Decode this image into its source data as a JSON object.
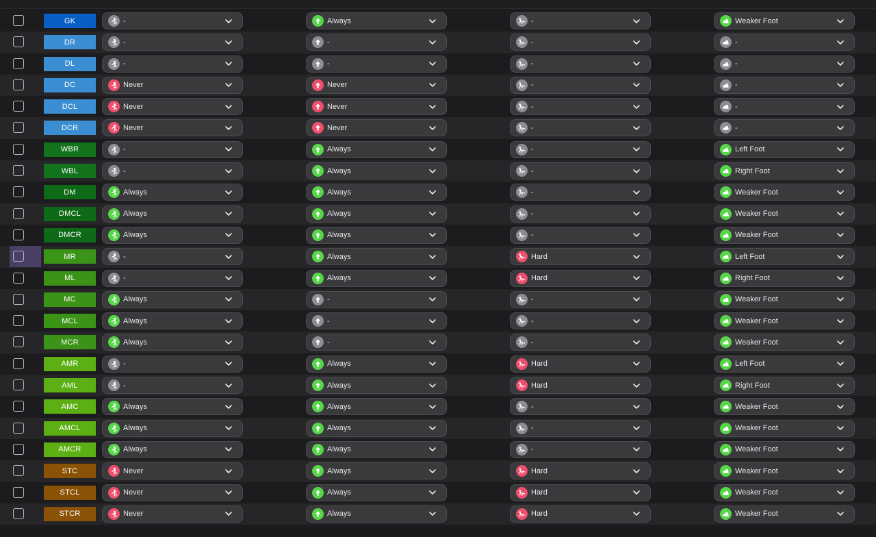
{
  "colors": {
    "grey_status": "#8d8d92",
    "green_status": "#58d64a",
    "red_status": "#ef4f6c",
    "pos_gk": "#0a5fc4",
    "pos_def": "#3b8ed1",
    "pos_wb": "#12731c",
    "pos_dm": "#0e6a17",
    "pos_mid": "#3b9318",
    "pos_am": "#5cb014",
    "pos_st": "#8a5207"
  },
  "icons": {
    "grey_status": "person-icon",
    "green_status": "person-icon",
    "red_status": "person-icon",
    "col1": "run-icon",
    "col2": "arrow-up-icon",
    "col3": "tackle-icon",
    "col4": "foot-icon"
  },
  "rows": [
    {
      "pos": "GK",
      "bg": "#0a5fc4",
      "c1": {
        "label": "-",
        "s": "gray"
      },
      "c2": {
        "label": "Always",
        "s": "green"
      },
      "c3": {
        "label": "-",
        "s": "gray"
      },
      "c4": {
        "label": "Weaker Foot",
        "s": "green"
      }
    },
    {
      "pos": "DR",
      "bg": "#3b8ed1",
      "c1": {
        "label": "-",
        "s": "gray"
      },
      "c2": {
        "label": "-",
        "s": "gray"
      },
      "c3": {
        "label": "-",
        "s": "gray"
      },
      "c4": {
        "label": "-",
        "s": "gray"
      }
    },
    {
      "pos": "DL",
      "bg": "#3b8ed1",
      "c1": {
        "label": "-",
        "s": "gray"
      },
      "c2": {
        "label": "-",
        "s": "gray"
      },
      "c3": {
        "label": "-",
        "s": "gray"
      },
      "c4": {
        "label": "-",
        "s": "gray"
      }
    },
    {
      "pos": "DC",
      "bg": "#3b8ed1",
      "c1": {
        "label": "Never",
        "s": "red"
      },
      "c2": {
        "label": "Never",
        "s": "red"
      },
      "c3": {
        "label": "-",
        "s": "gray"
      },
      "c4": {
        "label": "-",
        "s": "gray"
      }
    },
    {
      "pos": "DCL",
      "bg": "#3b8ed1",
      "c1": {
        "label": "Never",
        "s": "red"
      },
      "c2": {
        "label": "Never",
        "s": "red"
      },
      "c3": {
        "label": "-",
        "s": "gray"
      },
      "c4": {
        "label": "-",
        "s": "gray"
      }
    },
    {
      "pos": "DCR",
      "bg": "#3b8ed1",
      "c1": {
        "label": "Never",
        "s": "red"
      },
      "c2": {
        "label": "Never",
        "s": "red"
      },
      "c3": {
        "label": "-",
        "s": "gray"
      },
      "c4": {
        "label": "-",
        "s": "gray"
      }
    },
    {
      "pos": "WBR",
      "bg": "#12731c",
      "c1": {
        "label": "-",
        "s": "gray"
      },
      "c2": {
        "label": "Always",
        "s": "green"
      },
      "c3": {
        "label": "-",
        "s": "gray"
      },
      "c4": {
        "label": "Left Foot",
        "s": "green"
      }
    },
    {
      "pos": "WBL",
      "bg": "#12731c",
      "c1": {
        "label": "-",
        "s": "gray"
      },
      "c2": {
        "label": "Always",
        "s": "green"
      },
      "c3": {
        "label": "-",
        "s": "gray"
      },
      "c4": {
        "label": "Right Foot",
        "s": "green"
      }
    },
    {
      "pos": "DM",
      "bg": "#0e6a17",
      "c1": {
        "label": "Always",
        "s": "green"
      },
      "c2": {
        "label": "Always",
        "s": "green"
      },
      "c3": {
        "label": "-",
        "s": "gray"
      },
      "c4": {
        "label": "Weaker Foot",
        "s": "green"
      }
    },
    {
      "pos": "DMCL",
      "bg": "#0e6a17",
      "c1": {
        "label": "Always",
        "s": "green"
      },
      "c2": {
        "label": "Always",
        "s": "green"
      },
      "c3": {
        "label": "-",
        "s": "gray"
      },
      "c4": {
        "label": "Weaker Foot",
        "s": "green"
      }
    },
    {
      "pos": "DMCR",
      "bg": "#0e6a17",
      "c1": {
        "label": "Always",
        "s": "green"
      },
      "c2": {
        "label": "Always",
        "s": "green"
      },
      "c3": {
        "label": "-",
        "s": "gray"
      },
      "c4": {
        "label": "Weaker Foot",
        "s": "green"
      }
    },
    {
      "pos": "MR",
      "bg": "#3b9318",
      "selected": true,
      "c1": {
        "label": "-",
        "s": "gray"
      },
      "c2": {
        "label": "Always",
        "s": "green"
      },
      "c3": {
        "label": "Hard",
        "s": "red"
      },
      "c4": {
        "label": "Left Foot",
        "s": "green"
      }
    },
    {
      "pos": "ML",
      "bg": "#3b9318",
      "c1": {
        "label": "-",
        "s": "gray"
      },
      "c2": {
        "label": "Always",
        "s": "green"
      },
      "c3": {
        "label": "Hard",
        "s": "red"
      },
      "c4": {
        "label": "Right Foot",
        "s": "green"
      }
    },
    {
      "pos": "MC",
      "bg": "#3b9318",
      "c1": {
        "label": "Always",
        "s": "green"
      },
      "c2": {
        "label": "-",
        "s": "gray"
      },
      "c3": {
        "label": "-",
        "s": "gray"
      },
      "c4": {
        "label": "Weaker Foot",
        "s": "green"
      }
    },
    {
      "pos": "MCL",
      "bg": "#3b9318",
      "c1": {
        "label": "Always",
        "s": "green"
      },
      "c2": {
        "label": "-",
        "s": "gray"
      },
      "c3": {
        "label": "-",
        "s": "gray"
      },
      "c4": {
        "label": "Weaker Foot",
        "s": "green"
      }
    },
    {
      "pos": "MCR",
      "bg": "#3b9318",
      "c1": {
        "label": "Always",
        "s": "green"
      },
      "c2": {
        "label": "-",
        "s": "gray"
      },
      "c3": {
        "label": "-",
        "s": "gray"
      },
      "c4": {
        "label": "Weaker Foot",
        "s": "green"
      }
    },
    {
      "pos": "AMR",
      "bg": "#5cb014",
      "c1": {
        "label": "-",
        "s": "gray"
      },
      "c2": {
        "label": "Always",
        "s": "green"
      },
      "c3": {
        "label": "Hard",
        "s": "red"
      },
      "c4": {
        "label": "Left Foot",
        "s": "green"
      }
    },
    {
      "pos": "AML",
      "bg": "#5cb014",
      "c1": {
        "label": "-",
        "s": "gray"
      },
      "c2": {
        "label": "Always",
        "s": "green"
      },
      "c3": {
        "label": "Hard",
        "s": "red"
      },
      "c4": {
        "label": "Right Foot",
        "s": "green"
      }
    },
    {
      "pos": "AMC",
      "bg": "#5cb014",
      "c1": {
        "label": "Always",
        "s": "green"
      },
      "c2": {
        "label": "Always",
        "s": "green"
      },
      "c3": {
        "label": "-",
        "s": "gray"
      },
      "c4": {
        "label": "Weaker Foot",
        "s": "green"
      }
    },
    {
      "pos": "AMCL",
      "bg": "#5cb014",
      "c1": {
        "label": "Always",
        "s": "green"
      },
      "c2": {
        "label": "Always",
        "s": "green"
      },
      "c3": {
        "label": "-",
        "s": "gray"
      },
      "c4": {
        "label": "Weaker Foot",
        "s": "green"
      }
    },
    {
      "pos": "AMCR",
      "bg": "#5cb014",
      "c1": {
        "label": "Always",
        "s": "green"
      },
      "c2": {
        "label": "Always",
        "s": "green"
      },
      "c3": {
        "label": "-",
        "s": "gray"
      },
      "c4": {
        "label": "Weaker Foot",
        "s": "green"
      }
    },
    {
      "pos": "STC",
      "bg": "#8a5207",
      "c1": {
        "label": "Never",
        "s": "red"
      },
      "c2": {
        "label": "Always",
        "s": "green"
      },
      "c3": {
        "label": "Hard",
        "s": "red"
      },
      "c4": {
        "label": "Weaker Foot",
        "s": "green"
      }
    },
    {
      "pos": "STCL",
      "bg": "#8a5207",
      "c1": {
        "label": "Never",
        "s": "red"
      },
      "c2": {
        "label": "Always",
        "s": "green"
      },
      "c3": {
        "label": "Hard",
        "s": "red"
      },
      "c4": {
        "label": "Weaker Foot",
        "s": "green"
      }
    },
    {
      "pos": "STCR",
      "bg": "#8a5207",
      "c1": {
        "label": "Never",
        "s": "red"
      },
      "c2": {
        "label": "Always",
        "s": "green"
      },
      "c3": {
        "label": "Hard",
        "s": "red"
      },
      "c4": {
        "label": "Weaker Foot",
        "s": "green"
      }
    }
  ]
}
